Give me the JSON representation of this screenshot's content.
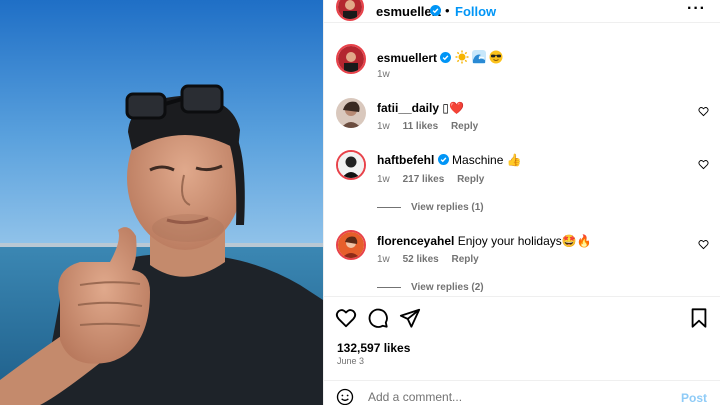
{
  "post": {
    "username": "esmuellert",
    "follow_label": "Follow",
    "dot": "•",
    "more_label": "···"
  },
  "caption": {
    "username": "esmuellert",
    "emojis": [
      "sun-emoji",
      "wave-emoji",
      "sunglasses-emoji"
    ],
    "time": "1w"
  },
  "comments": [
    {
      "username": "fatii__daily",
      "text": "▯❤️",
      "time": "1w",
      "likes": "11 likes",
      "reply": "Reply"
    },
    {
      "username": "haftbefehl",
      "verified": true,
      "text": "Maschine 👍",
      "time": "1w",
      "likes": "217 likes",
      "reply": "Reply",
      "view_replies": "View replies (1)"
    },
    {
      "username": "florenceyahel",
      "text": "Enjoy your holidays🤩🔥",
      "time": "1w",
      "likes": "52 likes",
      "reply": "Reply",
      "view_replies": "View replies (2)"
    }
  ],
  "stats": {
    "likes": "132,597 likes",
    "date": "June 3"
  },
  "composer": {
    "placeholder": "Add a comment...",
    "post_label": "Post"
  },
  "colors": {
    "accent": "#0095f6",
    "verified": "#0095f6",
    "post_disabled": "#8ecbf7",
    "muted": "#737373",
    "story_ring": "#e8424a"
  }
}
